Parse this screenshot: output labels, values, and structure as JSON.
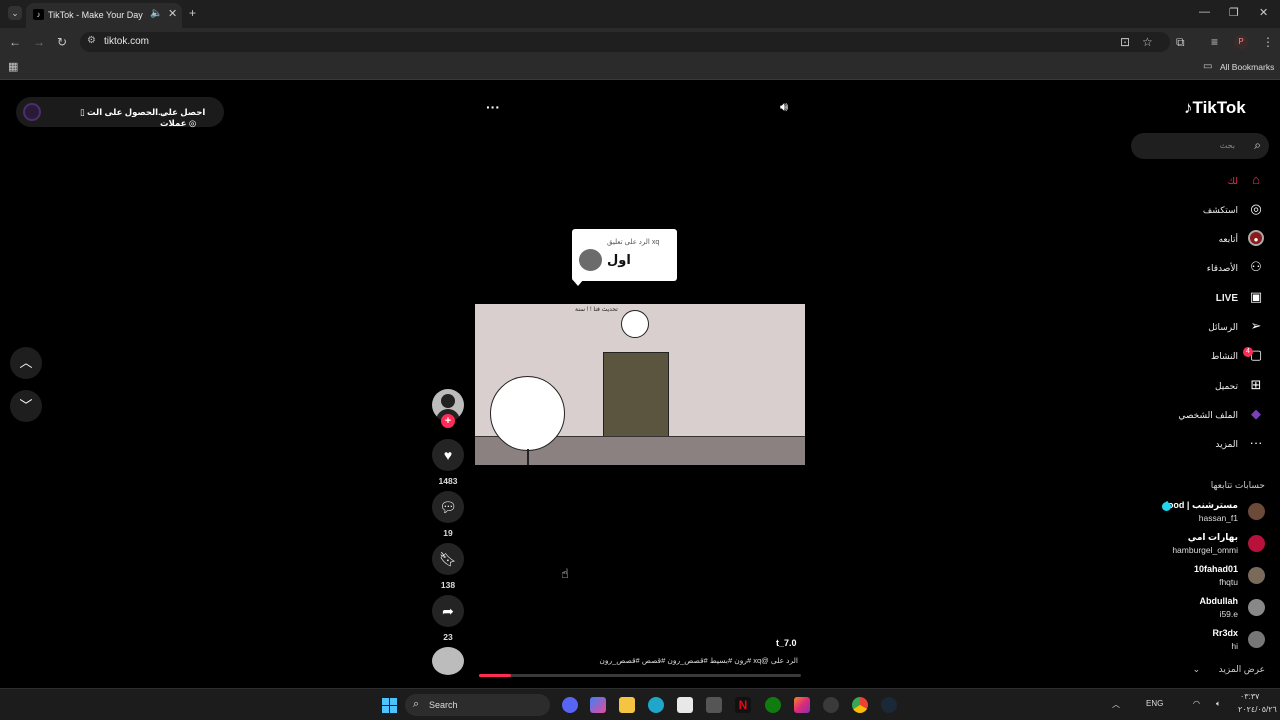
{
  "browser": {
    "tab_title": "TikTok - Make Your Day",
    "url": "tiktok.com",
    "bookmarks_label": "All Bookmarks",
    "profile_initial": "P"
  },
  "top_left_pill": {
    "item1": "احصل على عملات",
    "item2": "الحصول على الت..."
  },
  "video": {
    "reply_label": "الرد على تعليق xq",
    "reply_text": "اول",
    "caption_in_video": "تحديث فنا ! ! سنة",
    "author": "t_7.0",
    "description": "الرد على @xq  #رون  #بسيط  #قصص_رون  #قصص  #قصص_رون",
    "progress": 0.1
  },
  "actions": {
    "likes": "1483",
    "comments": "19",
    "saves": "138",
    "shares": "23"
  },
  "sidebar": {
    "logo": "TikTok",
    "search_placeholder": "بحث",
    "nav": [
      {
        "label": "لك",
        "icon": "home-icon"
      },
      {
        "label": "استكشف",
        "icon": "compass-icon"
      },
      {
        "label": "أتابعه",
        "icon": "following-avatar-icon"
      },
      {
        "label": "الأصدقاء",
        "icon": "friends-icon"
      },
      {
        "label": "LIVE",
        "icon": "live-icon"
      },
      {
        "label": "الرسائل",
        "icon": "messages-icon"
      },
      {
        "label": "النشاط",
        "icon": "activity-icon"
      },
      {
        "label": "تحميل",
        "icon": "upload-icon"
      },
      {
        "label": "الملف الشخصي",
        "icon": "profile-icon"
      },
      {
        "label": "المزيد",
        "icon": "more-icon"
      }
    ],
    "activity_badge": "4",
    "following_title": "حسابات تتابعها",
    "accounts": [
      {
        "name": "food | مسترشنب",
        "user": "hassan_f1"
      },
      {
        "name": "بهارات امي",
        "user": "hamburgel_ommi"
      },
      {
        "name": "10fahad01",
        "user": "fhqtu"
      },
      {
        "name": "Abdullah",
        "user": "i59.e"
      },
      {
        "name": "Rr3dx",
        "user": "hi"
      }
    ],
    "see_more": "عرض المزيد"
  },
  "taskbar": {
    "search_label": "Search",
    "lang": "ENG",
    "time": "٠٣:٣٧",
    "date": "٢٠٢٤/٠٥/٢٦"
  },
  "colors": {
    "accent": "#fe2c55",
    "bg": "#000000"
  }
}
